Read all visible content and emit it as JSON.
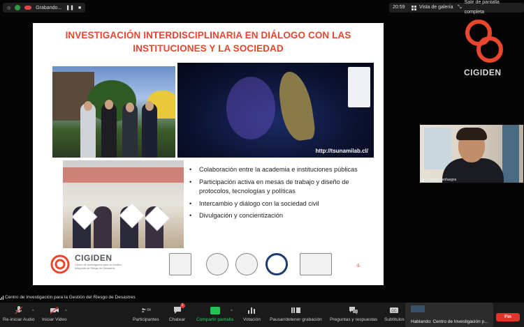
{
  "topbar": {
    "recording_label": "Grabando...",
    "time": "20:59",
    "gallery_view": "Vista de galería",
    "exit_fullscreen": "Salir de pantalla completa"
  },
  "slide": {
    "title_line1": "INVESTIGACIÓN INTERDISCIPLINARIA EN DIÁLOGO CON LAS",
    "title_line2": "INSTITUCIONES Y LA SOCIEDAD",
    "map_url": "http://tsunamilab.cl/",
    "bullets": [
      "Colaboración entre la academia e instituciones públicas",
      "Participación activa en mesas de trabajo y diseño de protocolos, tecnologías y políticas",
      "Intercambio y diálogo con la sociedad civil",
      "Divulgación y concientización"
    ],
    "logo_name": "CIGIDEN",
    "logo_subtitle": "Centro de Investigación para la Gestión Integrada de Riesgo de Desastres",
    "page_number": "-9-"
  },
  "side_logo": {
    "text": "CIGIDEN"
  },
  "participant": {
    "name": "Rodrigo Cienfuegos"
  },
  "share_bar": {
    "label": "Centro de Investigación para la Gestión del Riesgo de Desastres"
  },
  "toolbar": {
    "audio": "Re-iniciar Audio",
    "video": "Iniciar Video",
    "participants": "Participantes",
    "participants_count": "64",
    "chat": "Chatear",
    "chat_badge": "1",
    "share": "Compartir pantalla",
    "poll": "Votación",
    "pause_record": "Pausar/detener grabación",
    "qa": "Preguntas y respuestas",
    "subtitles": "Subtítulos",
    "end": "Fin"
  },
  "speaking": {
    "label": "Hablando: Centro de Investigación p..."
  },
  "colors": {
    "accent": "#e8462d",
    "share_green": "#23c257",
    "end_red": "#e0352b"
  }
}
